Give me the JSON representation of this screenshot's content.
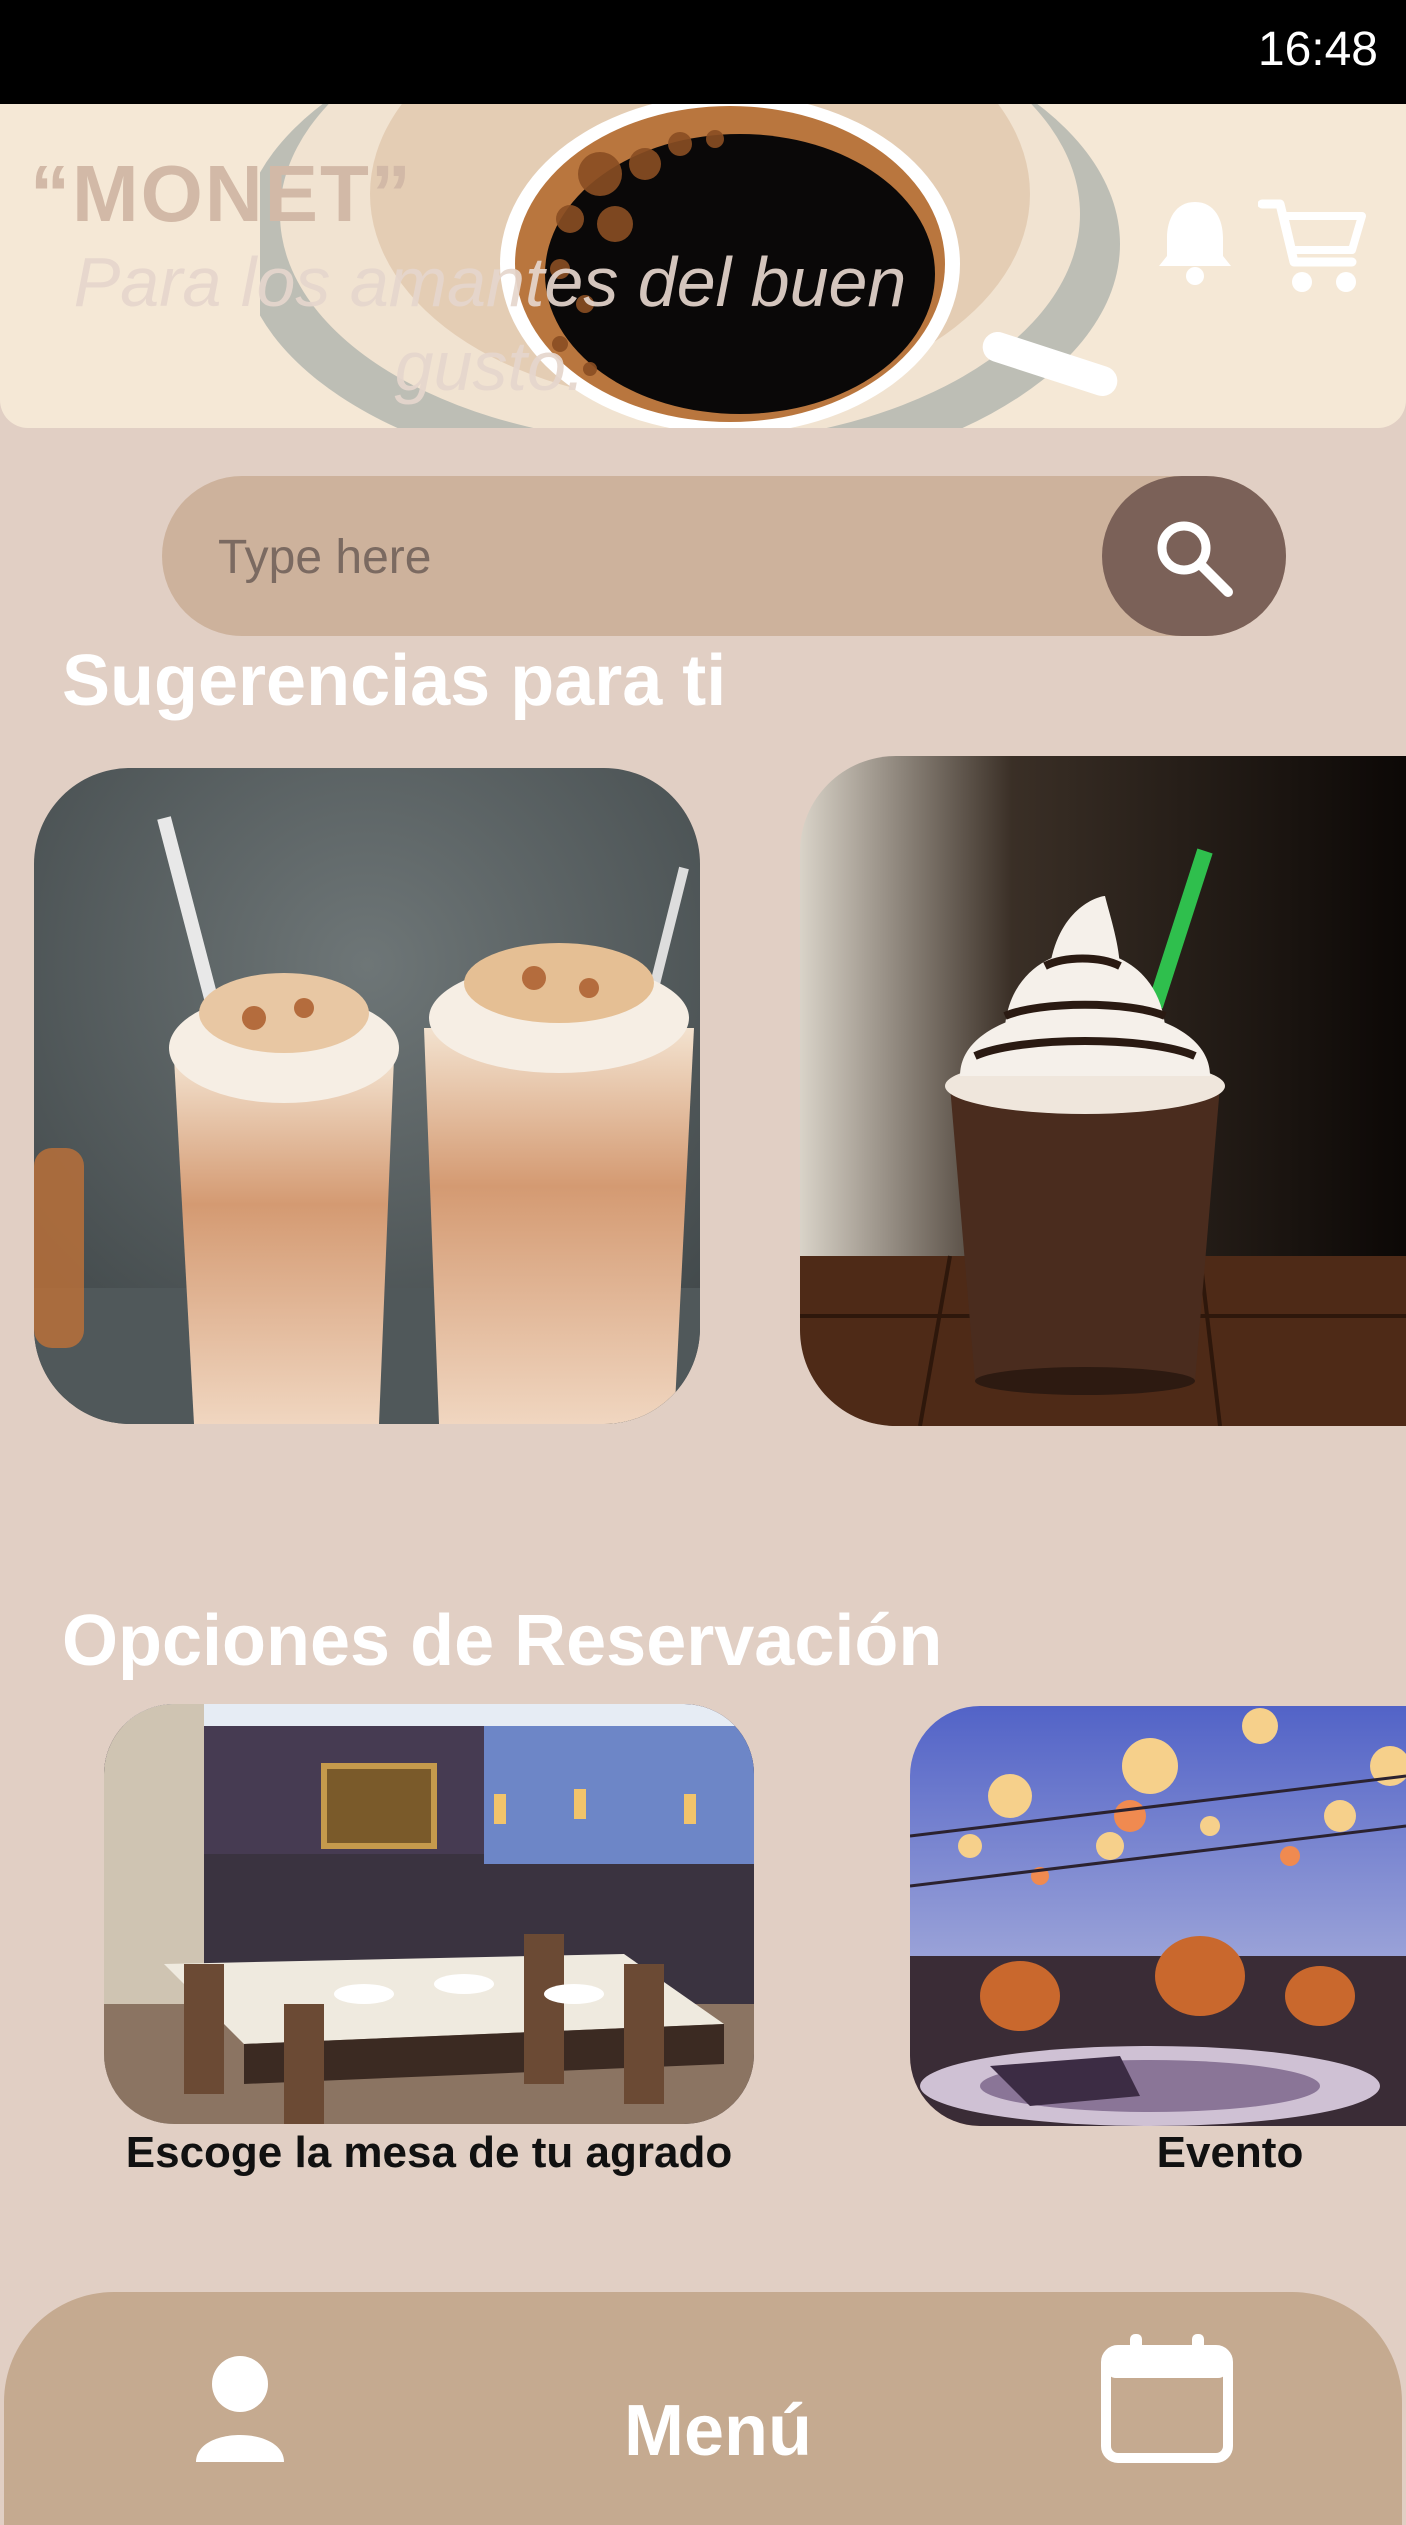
{
  "status_bar": {
    "time": "16:48"
  },
  "header": {
    "brand": "“MONET”",
    "tagline": "Para los amantes del buen gusto.",
    "icons": [
      "bell-icon",
      "cart-icon"
    ]
  },
  "search": {
    "placeholder": "Type here",
    "icon": "search-icon"
  },
  "suggestions": {
    "title": "Sugerencias para ti",
    "items": [
      {
        "image": "iced-coffee-shakes-photo"
      },
      {
        "image": "chocolate-frappe-photo"
      }
    ]
  },
  "reservations": {
    "title": "Opciones de Reservación",
    "items": [
      {
        "image": "restaurant-tables-photo",
        "caption": "Escoge la mesa de tu agrado"
      },
      {
        "image": "evento-lanterns-photo",
        "caption": "Evento"
      }
    ]
  },
  "bottom_nav": {
    "profile_icon": "user-icon",
    "menu_label": "Menú",
    "calendar_icon": "calendar-icon"
  },
  "colors": {
    "background": "#e1cfc4",
    "header": "#f5e8d6",
    "search_bar": "#cdb29c",
    "search_button": "#7b6158",
    "bottom_nav": "#c5aa90"
  }
}
